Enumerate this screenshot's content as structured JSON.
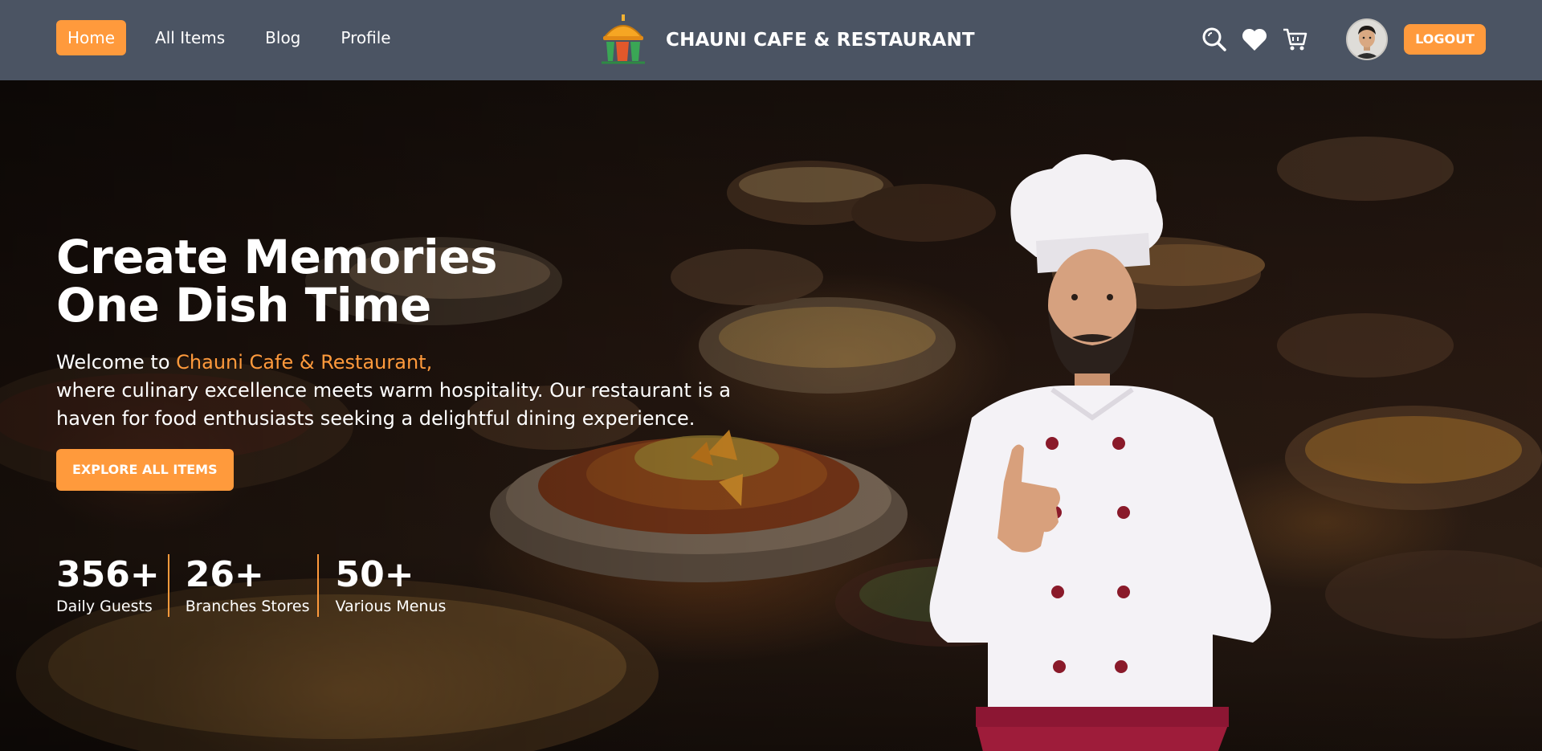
{
  "nav": {
    "links": [
      {
        "label": "Home",
        "active": true
      },
      {
        "label": "All Items",
        "active": false
      },
      {
        "label": "Blog",
        "active": false
      },
      {
        "label": "Profile",
        "active": false
      }
    ],
    "brand_name": "CHAUNI CAFE & RESTAURANT",
    "icons": [
      "search-icon",
      "heart-icon",
      "cart-icon"
    ],
    "logout_label": "LOGOUT"
  },
  "hero": {
    "headline_line1": "Create Memories",
    "headline_line2": "One Dish Time",
    "intro_prefix": "Welcome to ",
    "intro_accent": "Chauni Cafe & Restaurant,",
    "intro_rest": "where culinary excellence meets warm hospitality. Our restaurant is a haven for food enthusiasts seeking a delightful dining experience.",
    "cta_label": "EXPLORE ALL ITEMS",
    "stats": [
      {
        "value": "356+",
        "label": "Daily Guests"
      },
      {
        "value": "26+",
        "label": "Branches Stores"
      },
      {
        "value": "50+",
        "label": "Various Menus"
      }
    ]
  },
  "colors": {
    "navbar": "#4b5463",
    "accent": "#ff9a3c",
    "text": "#ffffff"
  }
}
